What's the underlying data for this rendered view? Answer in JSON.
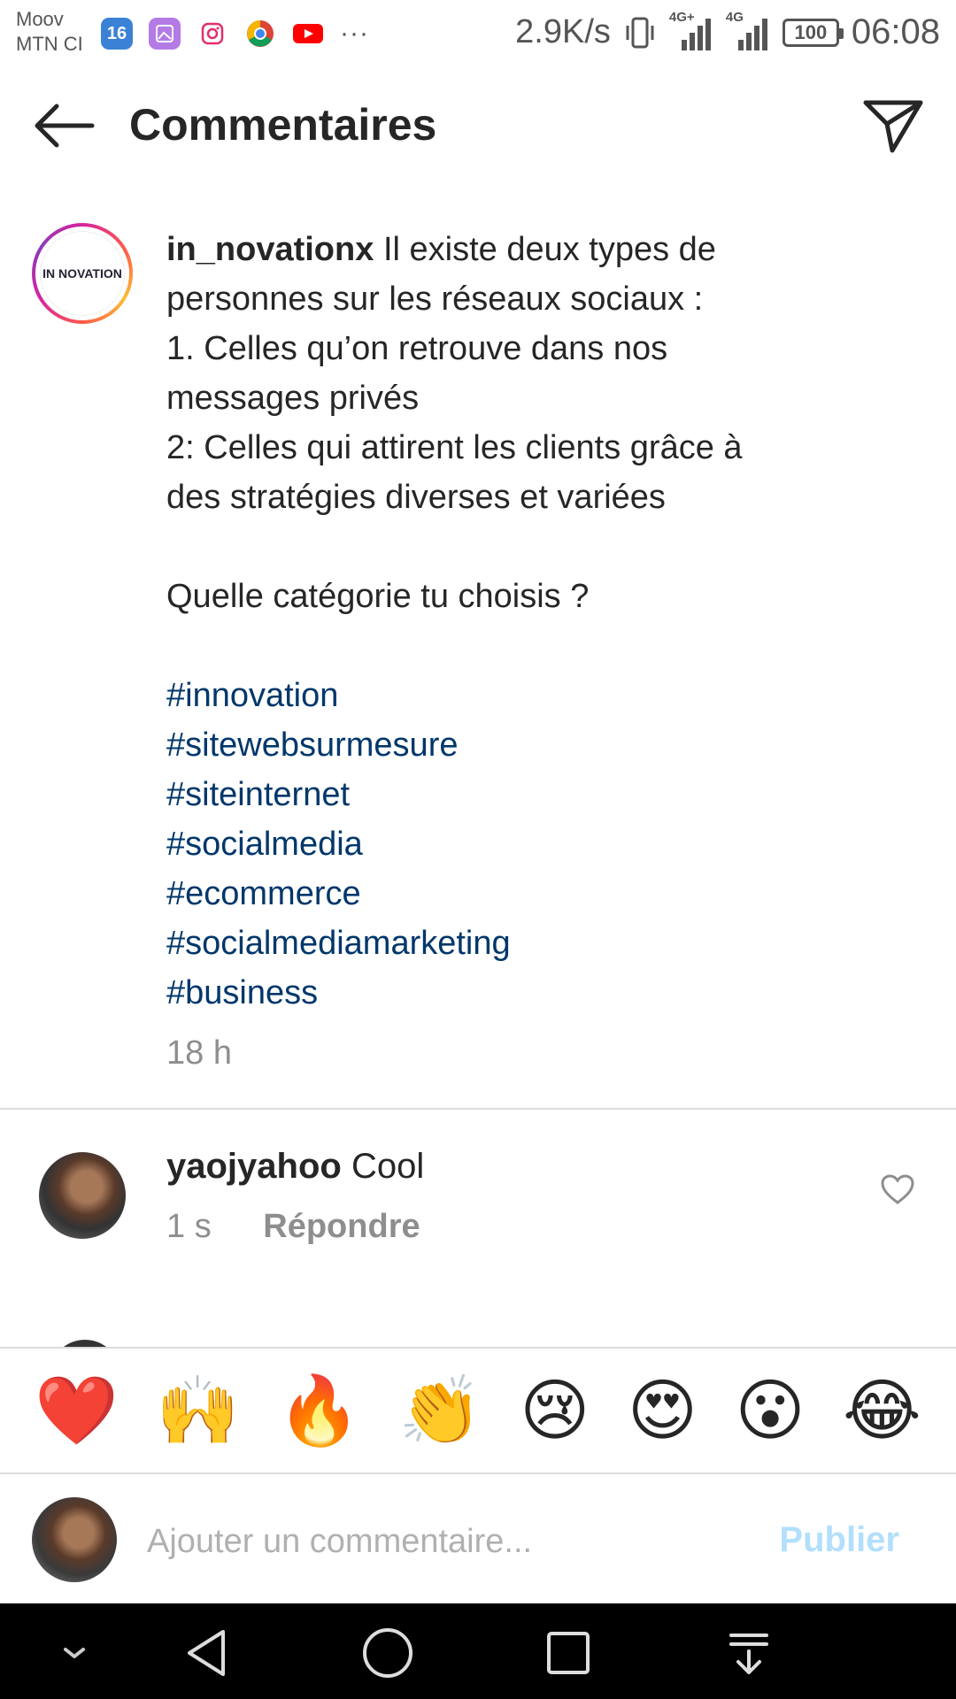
{
  "status_bar": {
    "carrier_1": "Moov",
    "carrier_2": "MTN CI",
    "app_icons": [
      "calendar-icon",
      "gallery-icon",
      "instagram-icon",
      "chrome-icon",
      "youtube-icon"
    ],
    "calendar_day": "16",
    "more": "···",
    "net_speed": "2.9K/s",
    "network_1": "4G+",
    "network_2": "4G",
    "battery": "100",
    "time": "06:08"
  },
  "header": {
    "title": "Commentaires",
    "back_icon": "arrow-left-icon",
    "send_icon": "paper-plane-icon"
  },
  "caption": {
    "username": "in_novationx",
    "logo_text": "IN NOVATION",
    "lines": [
      "Il existe deux types de",
      "personnes sur les réseaux sociaux :",
      "1. Celles qu’on retrouve dans nos",
      "messages privés",
      "2: Celles qui attirent les clients grâce à",
      "des stratégies diverses et variées",
      "",
      "Quelle catégorie tu choisis ?",
      ""
    ],
    "hashtags": [
      "#innovation",
      "#sitewebsurmesure",
      "#siteinternet",
      "#socialmedia",
      "#ecommerce",
      "#socialmediamarketing",
      "#business"
    ],
    "time": "18 h"
  },
  "comment": {
    "username": "yaojyahoo",
    "text": "Cool",
    "time": "1 s",
    "reply": "Répondre"
  },
  "emoji_bar": [
    "❤️",
    "🙌",
    "🔥",
    "👏",
    "😢",
    "😍",
    "😮",
    "😂"
  ],
  "add_comment": {
    "placeholder": "Ajouter un commentaire...",
    "publish": "Publier"
  },
  "colors": {
    "hashtag": "#00376b",
    "muted": "#8e8e8e",
    "publish_disabled": "#b2dffc",
    "divider": "#dbdbdb"
  }
}
